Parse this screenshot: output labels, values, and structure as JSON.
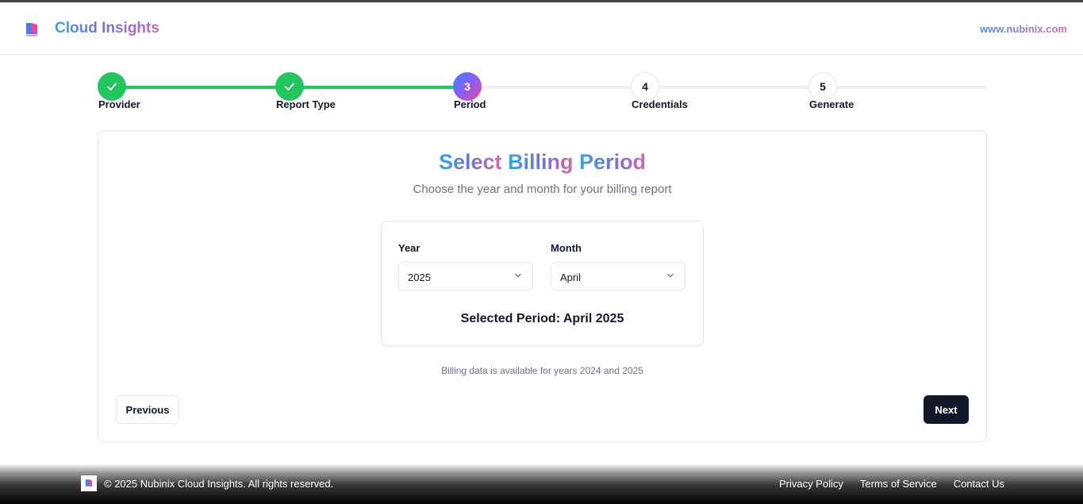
{
  "header": {
    "brand": "Cloud Insights",
    "site_link": "www.nubinix.com",
    "logo_icon": "nubinix-logo-icon"
  },
  "stepper": {
    "current_step": 3,
    "steps": [
      {
        "number": "1",
        "label": "Provider",
        "status": "done"
      },
      {
        "number": "2",
        "label": "Report Type",
        "status": "done"
      },
      {
        "number": "3",
        "label": "Period",
        "status": "active"
      },
      {
        "number": "4",
        "label": "Credentials",
        "status": "todo"
      },
      {
        "number": "5",
        "label": "Generate",
        "status": "todo"
      }
    ]
  },
  "card": {
    "title_words": [
      "Select",
      "Billing",
      "Period"
    ],
    "subtitle": "Choose the year and month for your billing report",
    "year_label": "Year",
    "year_value": "2025",
    "month_label": "Month",
    "month_value": "April",
    "selected_period": "Selected Period: April 2025",
    "note": "Billing data is available for years 2024 and 2025",
    "previous_label": "Previous",
    "next_label": "Next"
  },
  "footer": {
    "copyright": "© 2025 Nubinix Cloud Insights. All rights reserved.",
    "links": [
      "Privacy Policy",
      "Terms of Service",
      "Contact Us"
    ]
  },
  "colors": {
    "done_green": "#22c55e",
    "primary_dark": "#111827",
    "border": "#e5e7eb"
  }
}
